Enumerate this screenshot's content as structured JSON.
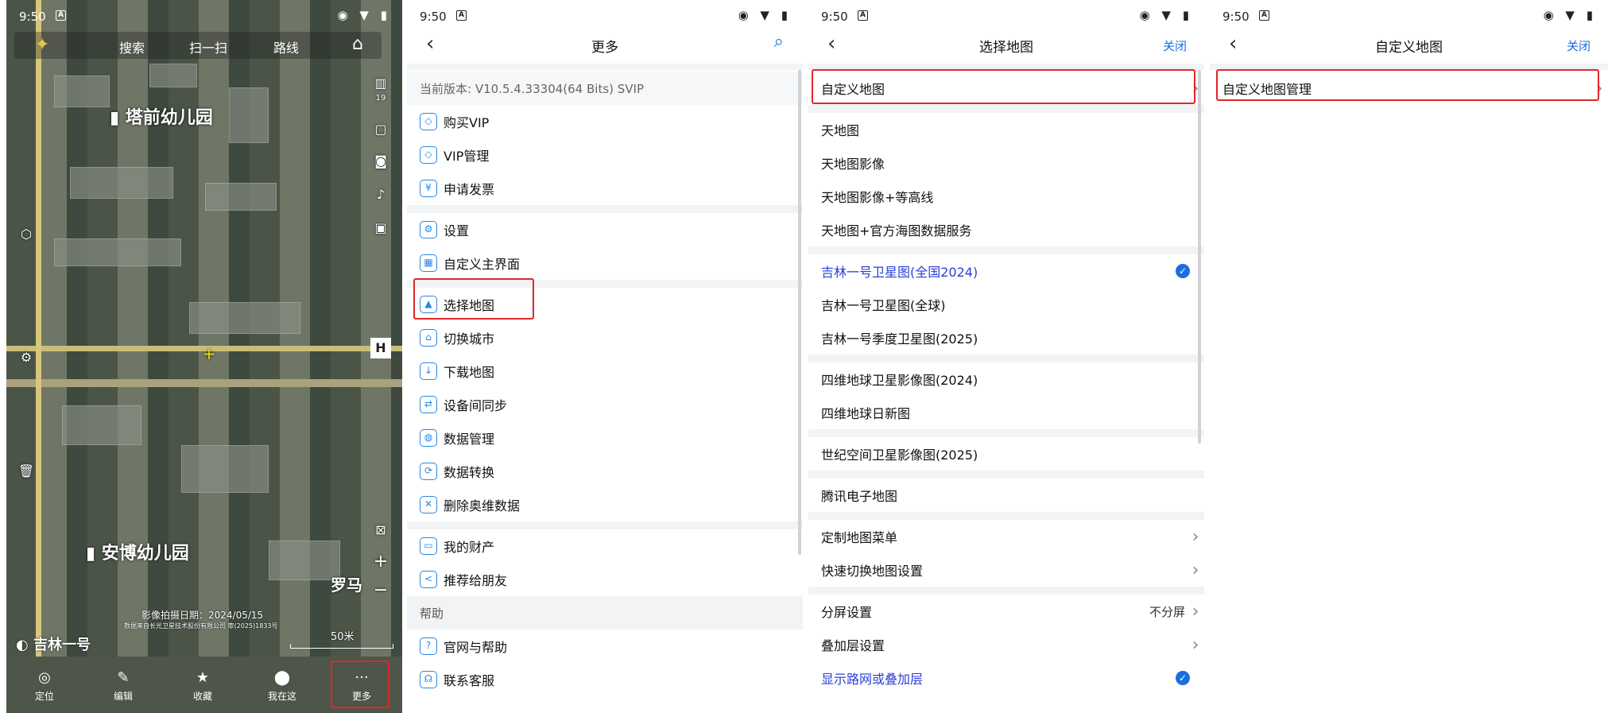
{
  "status": {
    "time": "9:50",
    "icons": "◉ ▼ ▮"
  },
  "p1": {
    "topbar": {
      "search": "搜索",
      "scan": "扫一扫",
      "route": "路线"
    },
    "labels": {
      "kindergarten1": "塔前幼儿园",
      "kindergarten2": "安博幼儿园",
      "luoma": "罗马",
      "zoom_level": "19"
    },
    "date": "影像拍摄日期：2024/05/15",
    "source": "数据来自长光卫星技术股份有限公司 审(2025)1833号",
    "brand": "吉林一号",
    "scale": "50米",
    "bottom": [
      {
        "label": "定位",
        "icon": "◎"
      },
      {
        "label": "编辑",
        "icon": "✎"
      },
      {
        "label": "收藏",
        "icon": "★"
      },
      {
        "label": "我在这",
        "icon": "⬤"
      },
      {
        "label": "更多",
        "icon": "···"
      }
    ]
  },
  "p2": {
    "title": "更多",
    "version": "当前版本: V10.5.4.33304(64 Bits) SVIP",
    "items": [
      {
        "label": "购买VIP",
        "icon": "◇"
      },
      {
        "label": "VIP管理",
        "icon": "◇"
      },
      {
        "label": "申请发票",
        "icon": "¥"
      },
      {
        "label": "设置",
        "icon": "⚙"
      },
      {
        "label": "自定义主界面",
        "icon": "▦"
      },
      {
        "label": "选择地图",
        "icon": "▲"
      },
      {
        "label": "切换城市",
        "icon": "⌂"
      },
      {
        "label": "下载地图",
        "icon": "↓"
      },
      {
        "label": "设备间同步",
        "icon": "⇄"
      },
      {
        "label": "数据管理",
        "icon": "◍"
      },
      {
        "label": "数据转换",
        "icon": "⟳"
      },
      {
        "label": "删除奥维数据",
        "icon": "✕"
      },
      {
        "label": "我的财产",
        "icon": "▭"
      },
      {
        "label": "推荐给朋友",
        "icon": "<"
      }
    ],
    "help_header": "帮助",
    "help_items": [
      {
        "label": "官网与帮助",
        "icon": "?"
      },
      {
        "label": "联系客服",
        "icon": "☊"
      }
    ]
  },
  "p3": {
    "title": "选择地图",
    "close": "关闭",
    "custom": "自定义地图",
    "tianditu": [
      "天地图",
      "天地图影像",
      "天地图影像+等高线",
      "天地图+官方海图数据服务"
    ],
    "jilin": [
      "吉林一号卫星图(全国2024)",
      "吉林一号卫星图(全球)",
      "吉林一号季度卫星图(2025)"
    ],
    "siwei": [
      "四维地球卫星影像图(2024)",
      "四维地球日新图"
    ],
    "shiji": "世纪空间卫星影像图(2025)",
    "tencent": "腾讯电子地图",
    "menu": [
      "定制地图菜单",
      "快速切换地图设置"
    ],
    "split": "分屏设置",
    "split_val": "不分屏",
    "overlay": "叠加层设置",
    "show_road": "显示路网或叠加层",
    "accent": "#1a6fe0",
    "selected_color": "#2a3fd8"
  },
  "p4": {
    "title": "自定义地图",
    "close": "关闭",
    "item": "自定义地图管理"
  }
}
